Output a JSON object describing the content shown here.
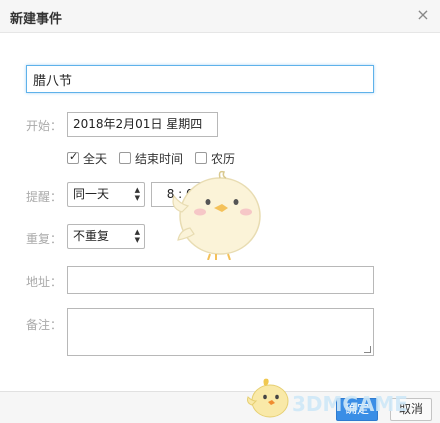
{
  "dialog": {
    "title": "新建事件",
    "close_glyph": "×"
  },
  "event": {
    "name_value": "腊八节"
  },
  "start": {
    "label": "开始：",
    "date_value": "2018年2月01日 星期四"
  },
  "options": [
    {
      "label": "全天",
      "checked": true
    },
    {
      "label": "结束时间",
      "checked": false
    },
    {
      "label": "农历",
      "checked": false
    }
  ],
  "remind": {
    "label": "提醒：",
    "selected": "同一天",
    "time_value": "8 : 00"
  },
  "repeat": {
    "label": "重复：",
    "selected": "不重复"
  },
  "address": {
    "label": "地址：",
    "value": ""
  },
  "note": {
    "label": "备注：",
    "value": ""
  },
  "footer": {
    "ok_label": "确定",
    "cancel_label": "取消"
  },
  "watermark": {
    "text": "3DMGAME"
  },
  "colors": {
    "accent": "#3a8ee6",
    "focus_border": "#5fb2ea",
    "label_gray": "#aaaaaa"
  }
}
